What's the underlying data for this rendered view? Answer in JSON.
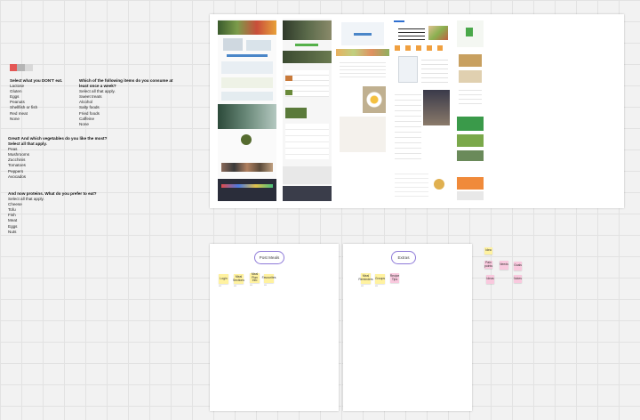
{
  "colors": {
    "red": "#e45755",
    "gray": "#b5b5b5",
    "light_gray": "#d8d8d8",
    "pill_border": "#8e7ad8",
    "sticky_yellow": "#fff2a0",
    "sticky_pink": "#f9c9de"
  },
  "questions": {
    "dont_eat": {
      "title": "Select what you DON'T eat.",
      "items": [
        "Lactose",
        "Gluten",
        "Eggs",
        "Peanuts",
        "Shellfish or fish",
        "Red meat",
        "None"
      ]
    },
    "consume_weekly": {
      "title_line1": "Which of the following items do you consume at",
      "title_line2": "least once a week?",
      "subtitle": "Select all that apply.",
      "items": [
        "Sweet treats",
        "Alcohol",
        "Salty foods",
        "Fried foods",
        "Caffeine",
        "None"
      ]
    },
    "vegetables": {
      "title": "Great! And which vegetables do you like the most?",
      "subtitle": "Select all that apply.",
      "items": [
        "Peas",
        "Mushrooms",
        "Zucchinis",
        "Tomatoes",
        "Peppers",
        "Avocados"
      ]
    },
    "proteins": {
      "title": "And now proteins. What do you prefer to eat?",
      "subtitle": "Select all that apply.",
      "items": [
        "Cheese",
        "Tofu",
        "Fish",
        "Meat",
        "Eggs",
        "Nuts"
      ]
    }
  },
  "boards": {
    "first": {
      "pill": "Post Meals",
      "stickies": [
        "Login",
        "Meal Sections",
        "Meal Plan Info",
        "Favourites"
      ]
    },
    "second": {
      "pill": "Extras",
      "stickies": [
        "Meal Reminders",
        "Groups",
        "Recipe Tips"
      ]
    }
  },
  "side_stickies": [
    "Idea",
    "Pain points",
    "Needs",
    "Goals",
    "Ideas",
    "Notes"
  ]
}
